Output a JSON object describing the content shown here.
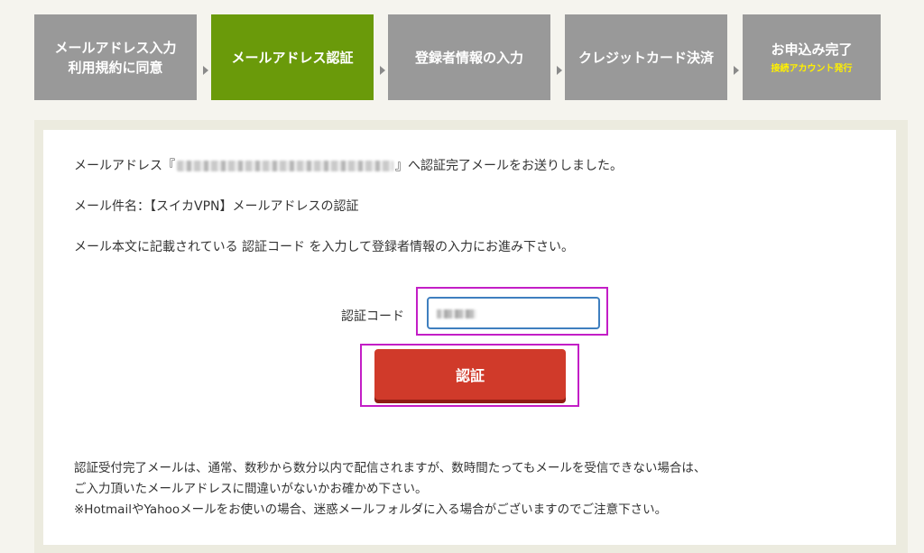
{
  "steps": [
    {
      "line1": "メールアドレス入力",
      "line2": "利用規約に同意",
      "sub": ""
    },
    {
      "line1": "メールアドレス認証",
      "line2": "",
      "sub": ""
    },
    {
      "line1": "登録者情報の入力",
      "line2": "",
      "sub": ""
    },
    {
      "line1": "クレジットカード決済",
      "line2": "",
      "sub": ""
    },
    {
      "line1": "お申込み完了",
      "line2": "",
      "sub": "接続アカウント発行"
    }
  ],
  "active_step_index": 1,
  "message": {
    "sent_prefix": "メールアドレス『",
    "sent_suffix": "』へ認証完了メールをお送りしました。",
    "subject": "メール件名：【スイカVPN】メールアドレスの認証",
    "instruction": "メール本文に記載されている 認証コード を入力して登録者情報の入力にお進み下さい。"
  },
  "form": {
    "code_label": "認証コード",
    "submit_label": "認証"
  },
  "notes": [
    "認証受付完了メールは、通常、数秒から数分以内で配信されますが、数時間たってもメールを受信できない場合は、",
    "ご入力頂いたメールアドレスに間違いがないかお確かめ下さい。",
    "※HotmailやYahooメールをお使いの場合、迷惑メールフォルダに入る場合がございますのでご注意下さい。"
  ],
  "colors": {
    "step_inactive": "#999999",
    "step_active": "#6a9a0a",
    "button": "#d03a2a",
    "highlight": "#c31ec6"
  }
}
